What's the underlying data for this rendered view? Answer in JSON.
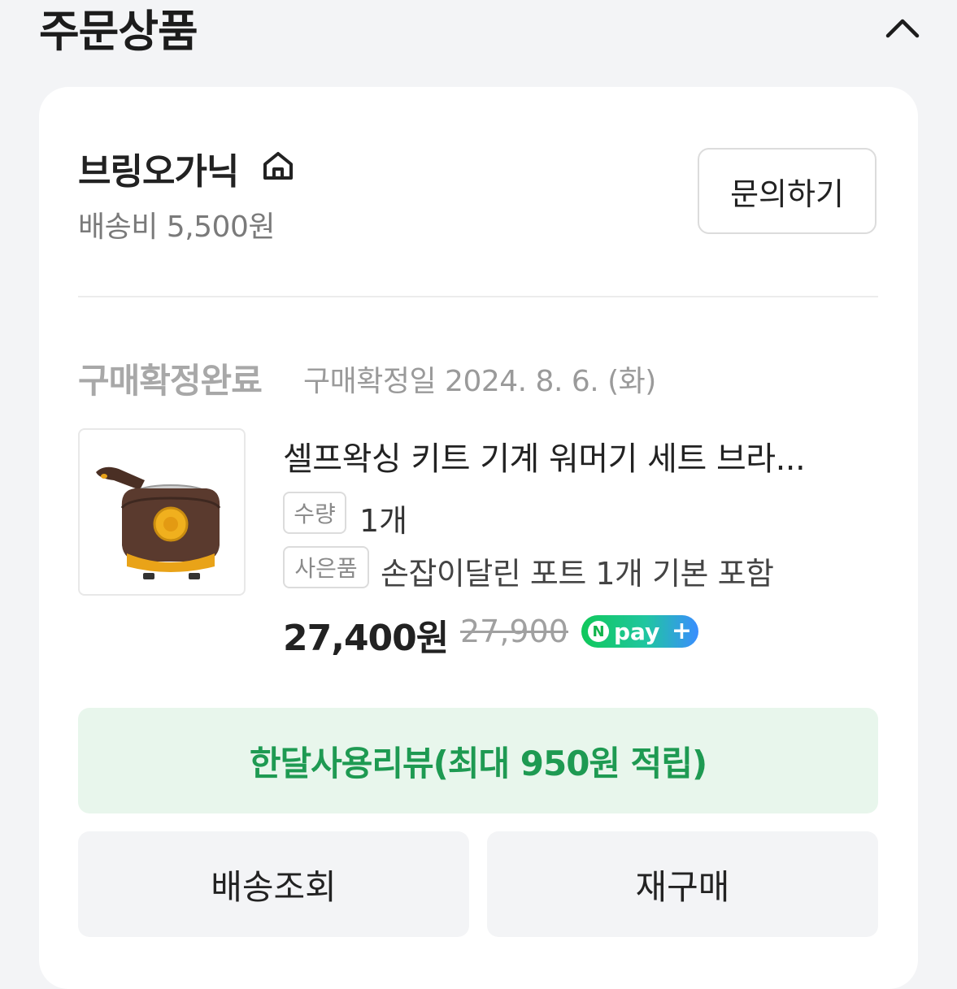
{
  "section": {
    "title": "주문상품",
    "collapse_icon": "chevron-up-icon"
  },
  "store": {
    "name": "브링오가닉",
    "home_icon": "home-icon",
    "shipping_fee": "배송비 5,500원",
    "inquiry_label": "문의하기"
  },
  "order": {
    "status": "구매확정완료",
    "confirm_date": "구매확정일 2024. 8. 6. (화)"
  },
  "product": {
    "name": "셀프왁싱 키트 기계 워머기 세트 브라...",
    "qty_label": "수량",
    "qty_value": "1개",
    "gift_label": "사은품",
    "gift_value": "손잡이달린 포트 1개 기본 포함",
    "price": "27,400원",
    "original_price": "27,900",
    "npay_n": "N",
    "npay_text": "pay",
    "npay_plus": "+"
  },
  "actions": {
    "review_label": "한달사용리뷰(최대 950원 적립)",
    "track_label": "배송조회",
    "rebuy_label": "재구매"
  },
  "colors": {
    "background": "#f3f4f6",
    "review_bg": "#e8f6ec",
    "review_text": "#1e9a52",
    "npay_green": "#10c85a",
    "npay_blue": "#3a8dff"
  }
}
